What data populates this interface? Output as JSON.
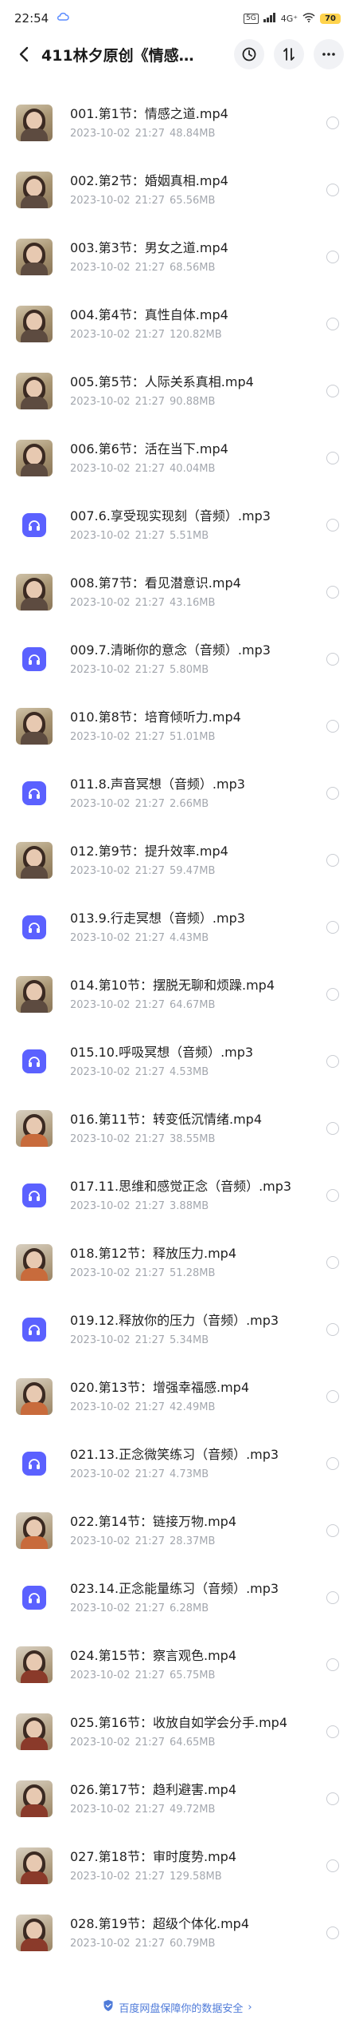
{
  "status_bar": {
    "time": "22:54",
    "right_text": "5G",
    "signal_text": "4G⁺",
    "battery": "70"
  },
  "app_bar": {
    "title": "411林夕原创《情感…"
  },
  "files": [
    {
      "name": "001.第1节：情感之道.mp4",
      "date": "2023-10-02",
      "time": "21:27",
      "size": "48.84MB",
      "type": "video"
    },
    {
      "name": "002.第2节：婚姻真相.mp4",
      "date": "2023-10-02",
      "time": "21:27",
      "size": "65.56MB",
      "type": "video"
    },
    {
      "name": "003.第3节：男女之道.mp4",
      "date": "2023-10-02",
      "time": "21:27",
      "size": "68.56MB",
      "type": "video"
    },
    {
      "name": "004.第4节：真性自体.mp4",
      "date": "2023-10-02",
      "time": "21:27",
      "size": "120.82MB",
      "type": "video"
    },
    {
      "name": "005.第5节：人际关系真相.mp4",
      "date": "2023-10-02",
      "time": "21:27",
      "size": "90.88MB",
      "type": "video"
    },
    {
      "name": "006.第6节：活在当下.mp4",
      "date": "2023-10-02",
      "time": "21:27",
      "size": "40.04MB",
      "type": "video"
    },
    {
      "name": "007.6.享受现实现刻（音频）.mp3",
      "date": "2023-10-02",
      "time": "21:27",
      "size": "5.51MB",
      "type": "audio"
    },
    {
      "name": "008.第7节：看见潜意识.mp4",
      "date": "2023-10-02",
      "time": "21:27",
      "size": "43.16MB",
      "type": "video"
    },
    {
      "name": "009.7.清晰你的意念（音频）.mp3",
      "date": "2023-10-02",
      "time": "21:27",
      "size": "5.80MB",
      "type": "audio"
    },
    {
      "name": "010.第8节：培育倾听力.mp4",
      "date": "2023-10-02",
      "time": "21:27",
      "size": "51.01MB",
      "type": "video"
    },
    {
      "name": "011.8.声音冥想（音频）.mp3",
      "date": "2023-10-02",
      "time": "21:27",
      "size": "2.66MB",
      "type": "audio"
    },
    {
      "name": "012.第9节：提升效率.mp4",
      "date": "2023-10-02",
      "time": "21:27",
      "size": "59.47MB",
      "type": "video"
    },
    {
      "name": "013.9.行走冥想（音频）.mp3",
      "date": "2023-10-02",
      "time": "21:27",
      "size": "4.43MB",
      "type": "audio"
    },
    {
      "name": "014.第10节：摆脱无聊和烦躁.mp4",
      "date": "2023-10-02",
      "time": "21:27",
      "size": "64.67MB",
      "type": "video"
    },
    {
      "name": "015.10.呼吸冥想（音频）.mp3",
      "date": "2023-10-02",
      "time": "21:27",
      "size": "4.53MB",
      "type": "audio"
    },
    {
      "name": "016.第11节：转变低沉情绪.mp4",
      "date": "2023-10-02",
      "time": "21:27",
      "size": "38.55MB",
      "type": "video2"
    },
    {
      "name": "017.11.思维和感觉正念（音频）.mp3",
      "date": "2023-10-02",
      "time": "21:27",
      "size": "3.88MB",
      "type": "audio"
    },
    {
      "name": "018.第12节：释放压力.mp4",
      "date": "2023-10-02",
      "time": "21:27",
      "size": "51.28MB",
      "type": "video2"
    },
    {
      "name": "019.12.释放你的压力（音频）.mp3",
      "date": "2023-10-02",
      "time": "21:27",
      "size": "5.34MB",
      "type": "audio"
    },
    {
      "name": "020.第13节：增强幸福感.mp4",
      "date": "2023-10-02",
      "time": "21:27",
      "size": "42.49MB",
      "type": "video2"
    },
    {
      "name": "021.13.正念微笑练习（音频）.mp3",
      "date": "2023-10-02",
      "time": "21:27",
      "size": "4.73MB",
      "type": "audio"
    },
    {
      "name": "022.第14节：链接万物.mp4",
      "date": "2023-10-02",
      "time": "21:27",
      "size": "28.37MB",
      "type": "video2"
    },
    {
      "name": "023.14.正念能量练习（音频）.mp3",
      "date": "2023-10-02",
      "time": "21:27",
      "size": "6.28MB",
      "type": "audio"
    },
    {
      "name": "024.第15节：察言观色.mp4",
      "date": "2023-10-02",
      "time": "21:27",
      "size": "65.75MB",
      "type": "video3"
    },
    {
      "name": "025.第16节：收放自如学会分手.mp4",
      "date": "2023-10-02",
      "time": "21:27",
      "size": "64.65MB",
      "type": "video3"
    },
    {
      "name": "026.第17节：趋利避害.mp4",
      "date": "2023-10-02",
      "time": "21:27",
      "size": "49.72MB",
      "type": "video3"
    },
    {
      "name": "027.第18节：审时度势.mp4",
      "date": "2023-10-02",
      "time": "21:27",
      "size": "129.58MB",
      "type": "video3"
    },
    {
      "name": "028.第19节：超级个体化.mp4",
      "date": "2023-10-02",
      "time": "21:27",
      "size": "60.79MB",
      "type": "video3"
    }
  ],
  "footer": {
    "text": "百度网盘保障你的数据安全",
    "chevron": "›"
  },
  "colors": {
    "accent": "#5b61ff",
    "footer_link": "#4f7bd9",
    "meta": "#a3a7ae"
  },
  "icons": {
    "back": "back-arrow-icon",
    "history": "history-clock-icon",
    "sort": "sort-icon",
    "more": "more-dots-icon",
    "audio": "music-note-icon",
    "shield": "shield-icon"
  }
}
